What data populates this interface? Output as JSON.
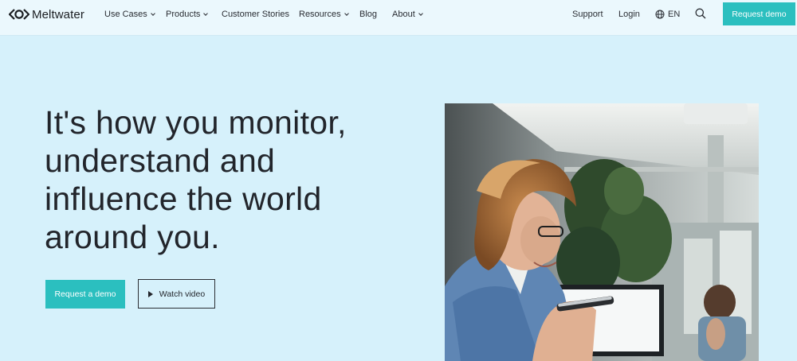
{
  "brand": {
    "name": "Meltwater"
  },
  "nav": {
    "items": [
      {
        "label": "Use Cases",
        "dropdown": true
      },
      {
        "label": "Products",
        "dropdown": true
      },
      {
        "label": "Customer Stories",
        "dropdown": false
      },
      {
        "label": "Resources",
        "dropdown": true
      },
      {
        "label": "Blog",
        "dropdown": false
      },
      {
        "label": "About",
        "dropdown": true
      }
    ],
    "support": "Support",
    "login": "Login",
    "language": "EN",
    "cta": "Request demo"
  },
  "hero": {
    "lines": [
      "It's how you monitor,",
      "understand and",
      "influence the world",
      "around you."
    ],
    "primary_cta": "Request a demo",
    "secondary_cta": "Watch video"
  },
  "icons": {
    "logo": "meltwater-logo-icon",
    "globe": "globe-icon",
    "search": "search-icon",
    "play": "play-icon",
    "chevron": "chevron-down-icon"
  },
  "colors": {
    "accent": "#2bbfbf",
    "hero_background": "#d6f1fb",
    "nav_background": "#ebf8fd",
    "text": "#22252b"
  }
}
